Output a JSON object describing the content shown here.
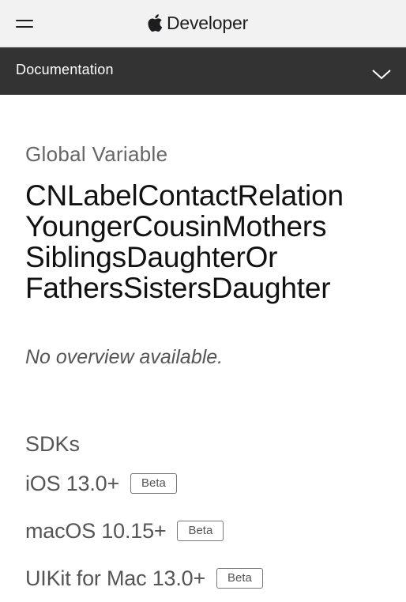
{
  "header": {
    "brand_label": "Developer",
    "menu_icon": "hamburger-menu-icon",
    "logo_icon": "apple-logo-icon"
  },
  "docbar": {
    "title": "Documentation",
    "chevron_icon": "chevron-down-icon"
  },
  "page": {
    "eyebrow": "Global Variable",
    "title_lines": [
      "CNLabelContactRelation",
      "YoungerCousinMothers",
      "SiblingsDaughterOr",
      "FathersSistersDaughter"
    ],
    "abstract": "No overview available."
  },
  "sdks": {
    "heading": "SDKs",
    "items": [
      {
        "name": "iOS 13.0+",
        "badge": "Beta"
      },
      {
        "name": "macOS 10.15+",
        "badge": "Beta"
      },
      {
        "name": "UIKit for Mac 13.0+",
        "badge": "Beta"
      }
    ]
  },
  "colors": {
    "topbar": "#f2f2f2",
    "docbar": "#333333",
    "text_primary": "#111111",
    "text_secondary": "#555555"
  }
}
